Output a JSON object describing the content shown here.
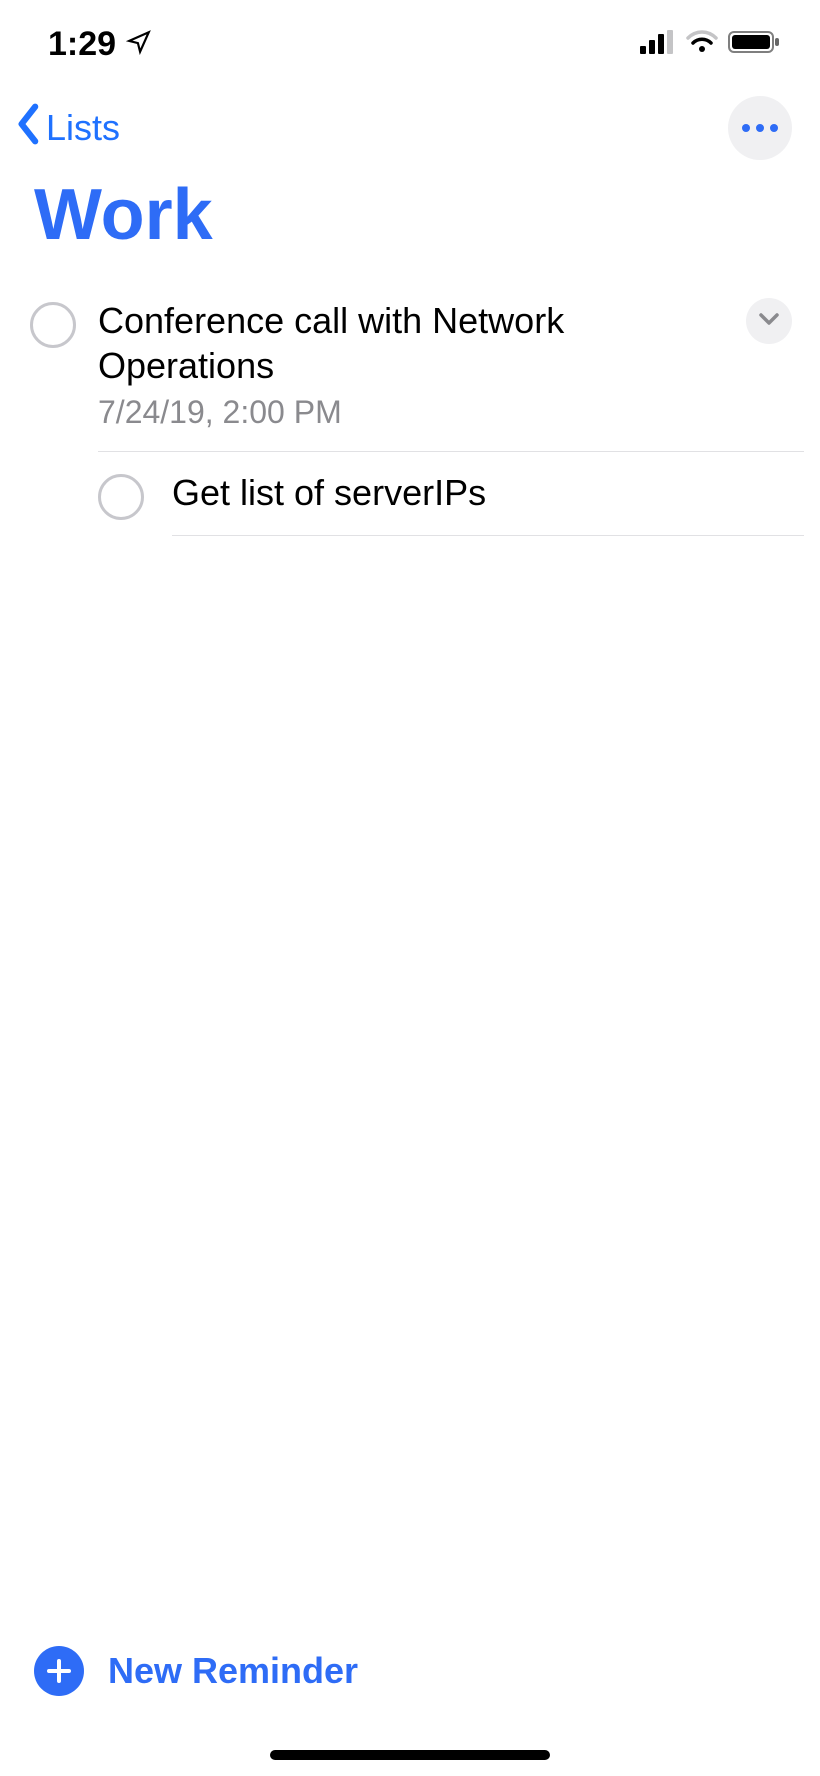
{
  "status": {
    "time": "1:29"
  },
  "nav": {
    "back_label": "Lists"
  },
  "list": {
    "title": "Work"
  },
  "reminders": [
    {
      "title": "Conference call with Network Operations",
      "subtitle": "7/24/19, 2:00 PM"
    },
    {
      "title": "Get list of serverIPs"
    }
  ],
  "footer": {
    "new_reminder_label": "New Reminder"
  }
}
